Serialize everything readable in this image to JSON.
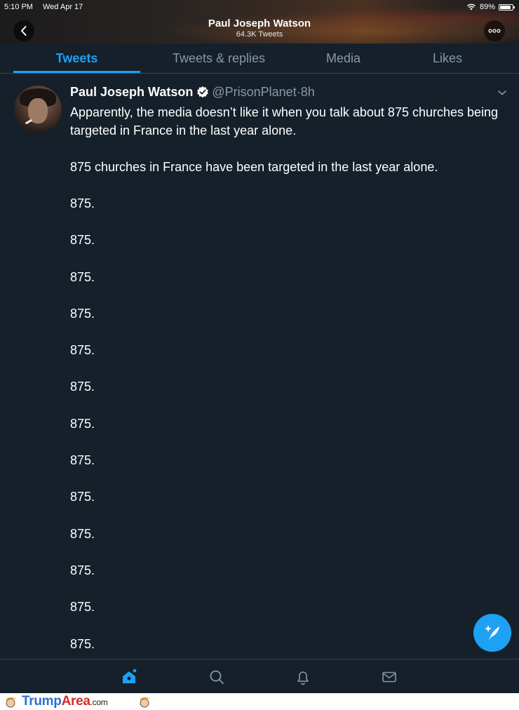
{
  "status_bar": {
    "time": "5:10 PM",
    "date": "Wed Apr 17",
    "battery": "89%",
    "battery_level": 0.89
  },
  "header": {
    "title": "Paul Joseph Watson",
    "subtitle": "64.3K Tweets"
  },
  "tabs": [
    {
      "label": "Tweets",
      "active": true
    },
    {
      "label": "Tweets & replies",
      "active": false
    },
    {
      "label": "Media",
      "active": false
    },
    {
      "label": "Likes",
      "active": false
    }
  ],
  "tweet": {
    "author": "Paul Joseph Watson",
    "handle": "@PrisonPlanet",
    "separator": "·",
    "age": "8h",
    "paragraph1": "Apparently, the media doesn’t like it when you talk about 875 churches being targeted in France in the last year alone.",
    "paragraph2": "875 churches in France have been targeted in the last year alone.",
    "repeats": [
      "875.",
      "875.",
      "875.",
      "875.",
      "875.",
      "875.",
      "875.",
      "875.",
      "875.",
      "875.",
      "875.",
      "875.",
      "875."
    ]
  },
  "watermark": {
    "brand_primary": "Trump",
    "brand_secondary": "Area",
    "suffix": ".com"
  },
  "colors": {
    "background": "#15202b",
    "accent": "#1da1f2",
    "muted": "#8899a6",
    "divider": "#38444d"
  },
  "icons": [
    "back-icon",
    "more-icon",
    "verified-icon",
    "caret-down-icon",
    "compose-icon",
    "home-icon",
    "search-icon",
    "bell-icon",
    "mail-icon",
    "wifi-icon",
    "battery-icon"
  ]
}
